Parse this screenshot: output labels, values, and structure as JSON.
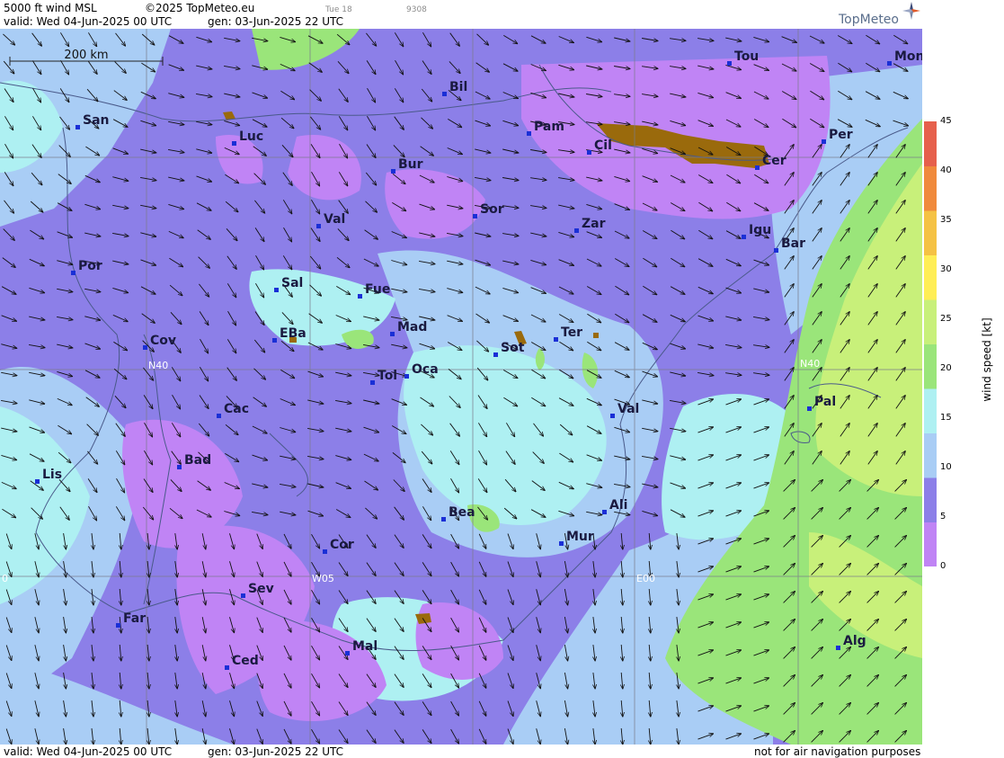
{
  "header": {
    "title": "5000 ft wind MSL",
    "copyright": "©2025 TopMeteo.eu",
    "small_day": "Tue 18",
    "small_code": "9308",
    "valid": "valid:  Wed  04-Jun-2025  00 UTC",
    "gen": "gen: 03-Jun-2025 22 UTC"
  },
  "brand": {
    "name": "TopMeteo"
  },
  "scale_bar": {
    "label": "200 km"
  },
  "grid_labels": {
    "lat_left": "N40",
    "lat_right": "N40",
    "lon_w05": "W05",
    "lon_e00": "E00",
    "lon_edge": "0"
  },
  "colorbar": {
    "label": "wind speed [kt]",
    "ticks": [
      "45",
      "40",
      "35",
      "30",
      "25",
      "20",
      "15",
      "10",
      "5",
      "0"
    ],
    "colors": [
      "#c084f5",
      "#8c7fe8",
      "#a9cdf5",
      "#aef0f2",
      "#9ae57a",
      "#c8f07a",
      "#ffee55",
      "#f5c244",
      "#f08a3c",
      "#e6604c"
    ]
  },
  "cities": [
    {
      "name": "Tou"
    },
    {
      "name": "Mon"
    },
    {
      "name": "Bil"
    },
    {
      "name": "San"
    },
    {
      "name": "Luc"
    },
    {
      "name": "Pam"
    },
    {
      "name": "Cil"
    },
    {
      "name": "Per"
    },
    {
      "name": "Bur"
    },
    {
      "name": "Cer"
    },
    {
      "name": "Sor"
    },
    {
      "name": "Val"
    },
    {
      "name": "Zar"
    },
    {
      "name": "Igu"
    },
    {
      "name": "Bar"
    },
    {
      "name": "Por"
    },
    {
      "name": "Sal"
    },
    {
      "name": "Fue"
    },
    {
      "name": "Mad"
    },
    {
      "name": "Cov"
    },
    {
      "name": "EBa"
    },
    {
      "name": "Sot"
    },
    {
      "name": "Ter"
    },
    {
      "name": "Tol"
    },
    {
      "name": "Oca"
    },
    {
      "name": "Pal"
    },
    {
      "name": "Cac"
    },
    {
      "name": "Val"
    },
    {
      "name": "Bad"
    },
    {
      "name": "Lis"
    },
    {
      "name": "Ali"
    },
    {
      "name": "Bea"
    },
    {
      "name": "Mur"
    },
    {
      "name": "Cor"
    },
    {
      "name": "Sev"
    },
    {
      "name": "Far"
    },
    {
      "name": "Alg"
    },
    {
      "name": "Mal"
    },
    {
      "name": "Ced"
    }
  ],
  "footer": {
    "valid": "valid:  Wed  04-Jun-2025  00 UTC",
    "gen": "gen: 03-Jun-2025 22 UTC",
    "disclaimer": "not for air navigation purposes"
  }
}
